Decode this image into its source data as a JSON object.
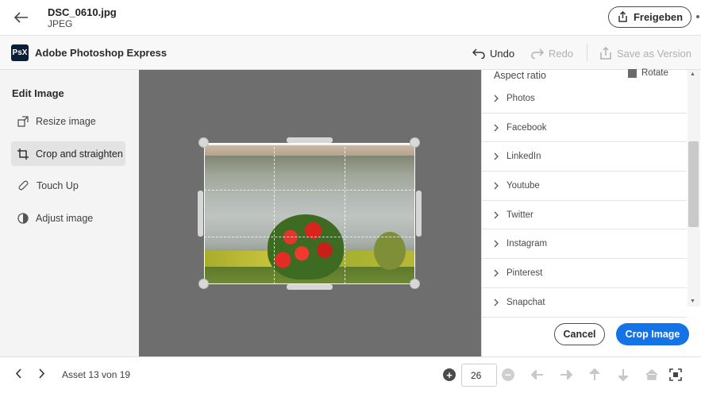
{
  "file": {
    "name": "DSC_0610.jpg",
    "type": "JPEG"
  },
  "header": {
    "share_label": "Freigeben"
  },
  "appbar": {
    "logo_text": "PsX",
    "app_name": "Adobe Photoshop Express",
    "undo_label": "Undo",
    "redo_label": "Redo",
    "save_version_label": "Save as Version"
  },
  "left_panel": {
    "title": "Edit Image",
    "tools": [
      {
        "label": "Resize image",
        "icon": "resize-icon",
        "active": false
      },
      {
        "label": "Crop and straighten",
        "icon": "crop-icon",
        "active": true
      },
      {
        "label": "Touch Up",
        "icon": "bandage-icon",
        "active": false
      },
      {
        "label": "Adjust image",
        "icon": "adjust-icon",
        "active": false
      }
    ]
  },
  "right_panel": {
    "section_title": "Aspect ratio",
    "rotate_label": "Rotate",
    "aspect_options": [
      "Photos",
      "Facebook",
      "LinkedIn",
      "Youtube",
      "Twitter",
      "Instagram",
      "Pinterest",
      "Snapchat"
    ],
    "cancel_label": "Cancel",
    "crop_label": "Crop Image"
  },
  "footer": {
    "asset_counter": "Asset 13 von 19",
    "zoom_value": "26"
  },
  "colors": {
    "accent": "#1473e6",
    "canvas_bg": "#6e6e6e",
    "panel_bg": "#f4f4f4"
  }
}
